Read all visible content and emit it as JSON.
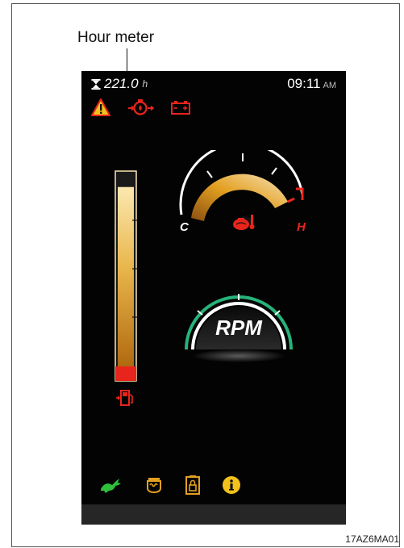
{
  "callout": {
    "label": "Hour meter"
  },
  "header": {
    "hour_value": "221.0",
    "hour_unit": "h",
    "time": "09:11",
    "ampm": "AM"
  },
  "warning_icons": [
    "warning-triangle-icon",
    "engine-oil-pressure-icon",
    "battery-charge-icon"
  ],
  "fuel_gauge": {
    "icon": "fuel-pump-icon",
    "level_fraction": 0.93,
    "reserve_color": "#e8251c"
  },
  "temp_gauge": {
    "cold_label": "C",
    "hot_label": "H",
    "icon": "coolant-temperature-icon"
  },
  "rpm_gauge": {
    "label": "RPM"
  },
  "status_icons": [
    "eco-mode-rabbit-icon",
    "glow-plug-icon",
    "door-lock-icon",
    "info-icon"
  ],
  "colors": {
    "warning_red": "#e8251c",
    "warning_yellow": "#f2c21b",
    "status_green": "#2fbf3a",
    "amber": "#e3a021",
    "rpm_ring_green": "#27b37a"
  },
  "figure_code": "17AZ6MA01"
}
